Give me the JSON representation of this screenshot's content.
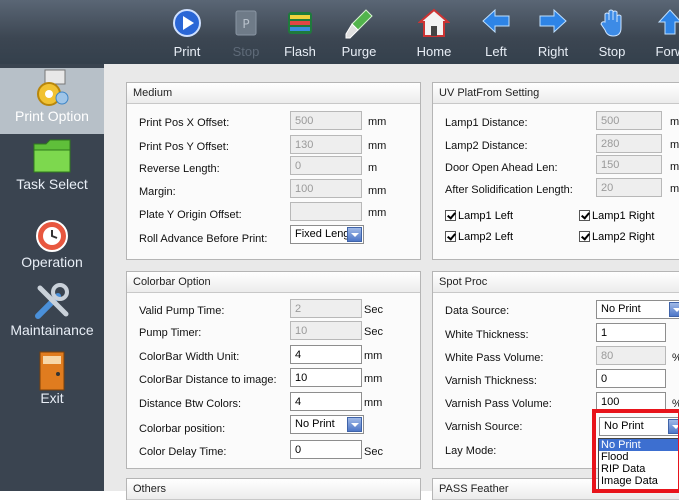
{
  "toolbar": {
    "print": "Print",
    "stop": "Stop",
    "flash": "Flash",
    "purge": "Purge",
    "home": "Home",
    "left": "Left",
    "right": "Right",
    "stop2": "Stop",
    "forward": "Forw"
  },
  "sidebar": {
    "print_option": "Print Option",
    "task_select": "Task Select",
    "operation": "Operation",
    "maintainance": "Maintainance",
    "exit": "Exit"
  },
  "medium": {
    "title": "Medium",
    "print_pos_x_label": "Print Pos X Offset:",
    "print_pos_x_value": "500",
    "print_pos_x_unit": "mm",
    "print_pos_y_label": "Print Pos Y Offset:",
    "print_pos_y_value": "130",
    "print_pos_y_unit": "mm",
    "reverse_length_label": "Reverse Length:",
    "reverse_length_value": "0",
    "reverse_length_unit": "m",
    "margin_label": "Margin:",
    "margin_value": "100",
    "margin_unit": "mm",
    "plate_y_label": "Plate Y Origin Offset:",
    "plate_y_value": "",
    "plate_y_unit": "mm",
    "roll_advance_label": "Roll Advance Before Print:",
    "roll_advance_value": "Fixed Length"
  },
  "uv": {
    "title": "UV PlatFrom Setting",
    "lamp1_distance_label": "Lamp1 Distance:",
    "lamp1_distance_value": "500",
    "lamp1_distance_unit": "m",
    "lamp2_distance_label": "Lamp2 Distance:",
    "lamp2_distance_value": "280",
    "lamp2_distance_unit": "m",
    "door_open_label": "Door Open Ahead Len:",
    "door_open_value": "150",
    "door_open_unit": "m",
    "after_solid_label": "After Solidification Length:",
    "after_solid_value": "20",
    "after_solid_unit": "m",
    "lamp1_left": "Lamp1 Left",
    "lamp1_right": "Lamp1 Right",
    "lamp2_left": "Lamp2 Left",
    "lamp2_right": "Lamp2 Right"
  },
  "colorbar": {
    "title": "Colorbar Option",
    "valid_pump_label": "Valid Pump Time:",
    "valid_pump_value": "2",
    "valid_pump_unit": "Sec",
    "pump_timer_label": "Pump Timer:",
    "pump_timer_value": "10",
    "pump_timer_unit": "Sec",
    "width_unit_label": "ColorBar Width Unit:",
    "width_unit_value": "4",
    "width_unit_unit": "mm",
    "distance_image_label": "ColorBar Distance to image:",
    "distance_image_value": "10",
    "distance_image_unit": "mm",
    "distance_colors_label": "Distance Btw Colors:",
    "distance_colors_value": "4",
    "distance_colors_unit": "mm",
    "position_label": "Colorbar position:",
    "position_value": "No Print",
    "delay_label": "Color Delay Time:",
    "delay_value": "0",
    "delay_unit": "Sec"
  },
  "spot": {
    "title": "Spot Proc",
    "data_source_label": "Data Source:",
    "data_source_value": "No Print",
    "white_thickness_label": "White Thickness:",
    "white_thickness_value": "1",
    "white_pass_label": "White Pass Volume:",
    "white_pass_value": "80",
    "white_pass_unit": "%",
    "varnish_thickness_label": "Varnish Thickness:",
    "varnish_thickness_value": "0",
    "varnish_pass_label": "Varnish Pass Volume:",
    "varnish_pass_value": "100",
    "varnish_pass_unit": "%",
    "varnish_source_label": "Varnish Source:",
    "varnish_source_value": "No Print",
    "lay_mode_label": "Lay Mode:",
    "dropdown_options": [
      "No Print",
      "Flood",
      "RIP Data",
      "Image Data"
    ]
  },
  "others": {
    "title": "Others"
  },
  "pass_feather": {
    "title": "PASS Feather"
  }
}
